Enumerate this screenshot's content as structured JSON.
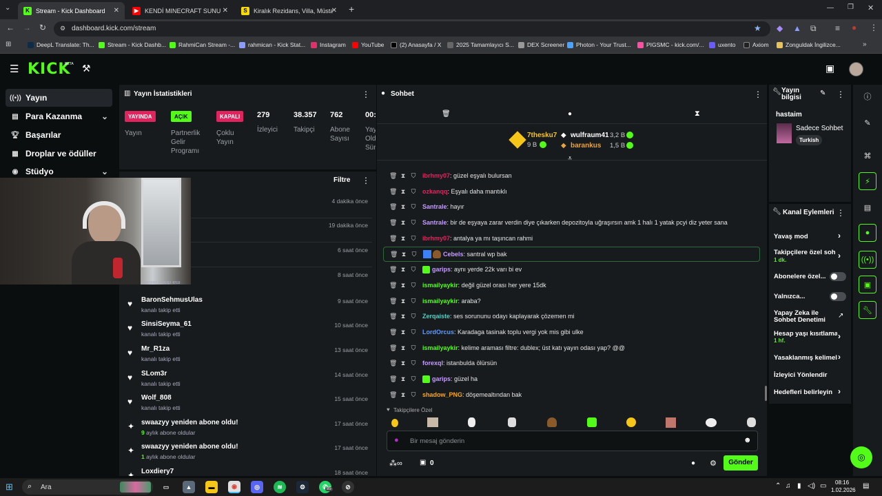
{
  "browser": {
    "tabs": [
      {
        "title": "Stream - Kick Dashboard",
        "active": true
      },
      {
        "title": "KENDİ MINECRAFT SUNUCUMU",
        "active": false
      },
      {
        "title": "Kiralık Rezidans, Villa, Müstakil",
        "active": false
      }
    ],
    "url": "dashboard.kick.com/stream",
    "bookmarks": [
      "DeepL Translate: Th...",
      "Stream - Kick Dashb...",
      "RahmiCan Stream -...",
      "rahmican - Kick Stat...",
      "Instagram",
      "YouTube",
      "(2) Anasayfa / X",
      "2025 Tamamlayıcı S...",
      "DEX Screener",
      "Photon - Your Trust...",
      "PIGSMC - kick.com/...",
      "uxento",
      "Axiom",
      "Zonguldak İngilizce..."
    ]
  },
  "header": {
    "logo": "KICK",
    "logo_sup": "BETA"
  },
  "sidebar": {
    "items": [
      {
        "label": "Yayın",
        "icon": "broadcast-icon"
      },
      {
        "label": "Para Kazanma",
        "icon": "money-icon"
      },
      {
        "label": "Başarılar",
        "icon": "trophy-icon"
      },
      {
        "label": "Droplar ve ödüller",
        "icon": "gift-icon"
      },
      {
        "label": "Stüdyo",
        "icon": "studio-icon"
      }
    ]
  },
  "stats": {
    "title": "Yayın İstatistikleri",
    "badges": [
      {
        "label": "YAYINDA",
        "caption": "Yayın"
      },
      {
        "label": "AÇIK",
        "caption": "Partnerlik Gelir Programı"
      },
      {
        "label": "KAPALI",
        "caption": "Çoklu Yayın"
      }
    ],
    "numbers": [
      {
        "value": "279",
        "caption": "İzleyici"
      },
      {
        "value": "38.357",
        "caption": "Takipçi"
      },
      {
        "value": "762",
        "caption": "Abone Sayısı"
      },
      {
        "value": "00:",
        "caption": "Yay Old Sür"
      }
    ]
  },
  "activity": {
    "filter": "Filtre",
    "hidden_times": [
      "4 dakika önce",
      "19 dakika önce",
      "6 saat önce",
      "8 saat önce"
    ],
    "partial_sub": "kanalı takip etti",
    "items": [
      {
        "name": "BaronSehmusUlas",
        "sub": "kanalı takip etti",
        "time": "9 saat önce",
        "type": "follow"
      },
      {
        "name": "SinsiSeyma_61",
        "sub": "kanalı takip etti",
        "time": "10 saat önce",
        "type": "follow"
      },
      {
        "name": "Mr_R1za",
        "sub": "kanalı takip etti",
        "time": "13 saat önce",
        "type": "follow"
      },
      {
        "name": "SLom3r",
        "sub": "kanalı takip etti",
        "time": "14 saat önce",
        "type": "follow"
      },
      {
        "name": "Wolf_808",
        "sub": "kanalı takip etti",
        "time": "15 saat önce",
        "type": "follow"
      },
      {
        "name": "swaazyy yeniden abone oldu!",
        "sub_num": "9",
        "sub": "aylık abone oldular",
        "time": "17 saat önce",
        "type": "sub"
      },
      {
        "name": "swaazyy yeniden abone oldu!",
        "sub_num": "1",
        "sub": "aylık abone oldular",
        "time": "17 saat önce",
        "type": "sub"
      },
      {
        "name": "Loxdiery7",
        "sub": "",
        "time": "18 saat önce",
        "type": "sub"
      }
    ]
  },
  "chat": {
    "title": "Sohbet",
    "leaderboard": [
      {
        "name": "7thesku7",
        "amount": "9 B",
        "color": "#f5c518"
      },
      {
        "name": "wulfraum41",
        "amount": "3,2 B",
        "color": "#ffffff"
      },
      {
        "name": "barankus",
        "amount": "1,5 B",
        "color": "#e8a33d"
      }
    ],
    "messages": [
      {
        "user": "ibrhmy07",
        "text": "güzel eşyalı bulursan",
        "color": "#e0245e"
      },
      {
        "user": "ozkanqq",
        "text": "Eşyalı daha mantıklı",
        "color": "#e0245e"
      },
      {
        "user": "Santrale",
        "text": "hayır",
        "color": "#c59cff"
      },
      {
        "user": "Santrale",
        "text": "bir de eşyaya zarar verdin diye çıkarken depozitoyla uğraşırsın amk 1 halı 1 yatak pcyi diz yeter sana",
        "color": "#c59cff"
      },
      {
        "user": "ibrhmy07",
        "text": "antalya ya mı taşıncan rahmi",
        "color": "#e0245e"
      },
      {
        "user": "Cebels",
        "text": "santral wp bak",
        "color": "#c59cff"
      },
      {
        "user": "garips",
        "text": "aynı yerde 22k varı bi ev",
        "color": "#c59cff"
      },
      {
        "user": "ismailyaykir",
        "text": "değil güzel orası her yere 15dk",
        "color": "#53fc18"
      },
      {
        "user": "ismailyaykir",
        "text": "araba?",
        "color": "#53fc18"
      },
      {
        "user": "Zerqaiste",
        "text": "ses sorununu odayı kaplayarak çözemen mi",
        "color": "#4fd1c5"
      },
      {
        "user": "LordOrcus",
        "text": "Karadaga tasinak toplu vergi yok mis gibi ulke",
        "color": "#5b9cff"
      },
      {
        "user": "ismailyaykir",
        "text": "kelime araması filtre: dublex; üst katı yayın odası yap? @@",
        "color": "#53fc18"
      },
      {
        "user": "forexql",
        "text": "istanbulda ölürsün",
        "color": "#c59cff"
      },
      {
        "user": "garips",
        "text": "güzel ha",
        "color": "#c59cff"
      },
      {
        "user": "shadow_PNG",
        "text": "döşemealtından bak",
        "color": "#f5a623"
      }
    ],
    "followers_only": "Takipçilere Özel",
    "input_placeholder": "Bir mesaj gönderin",
    "counter": "0",
    "send": "Gönder"
  },
  "info": {
    "title": "Yayın bilgisi",
    "channel": "hastaim",
    "category": "Sadece Sohbet",
    "tag": "Turkish"
  },
  "actions": {
    "title": "Kanal Eylemleri",
    "items": [
      {
        "label": "Yavaş mod",
        "kind": "chevron"
      },
      {
        "label": "Takipçilere özel soh",
        "sub": "1 dk.",
        "kind": "chevron"
      },
      {
        "label": "Abonelere özel...",
        "kind": "toggle"
      },
      {
        "label": "Yalnızca...",
        "kind": "toggle"
      },
      {
        "label": "Yapay Zeka ile Sohbet Denetimi",
        "kind": "external"
      },
      {
        "label": "Hesap yaşı kısıtlama",
        "sub": "1 hf.",
        "kind": "chevron"
      },
      {
        "label": "Yasaklanmış kelimel",
        "kind": "chevron"
      },
      {
        "label": "İzleyici Yönlendir",
        "kind": "none"
      },
      {
        "label": "Hedefleri belirleyin",
        "kind": "chevron"
      }
    ]
  },
  "taskbar": {
    "search": "Ara",
    "time": "08:16",
    "date": "1.02.2026",
    "whatsapp_count": "85"
  },
  "colors": {
    "accent": "#53fc18",
    "live": "#e0245e",
    "panel": "#181b1d"
  }
}
